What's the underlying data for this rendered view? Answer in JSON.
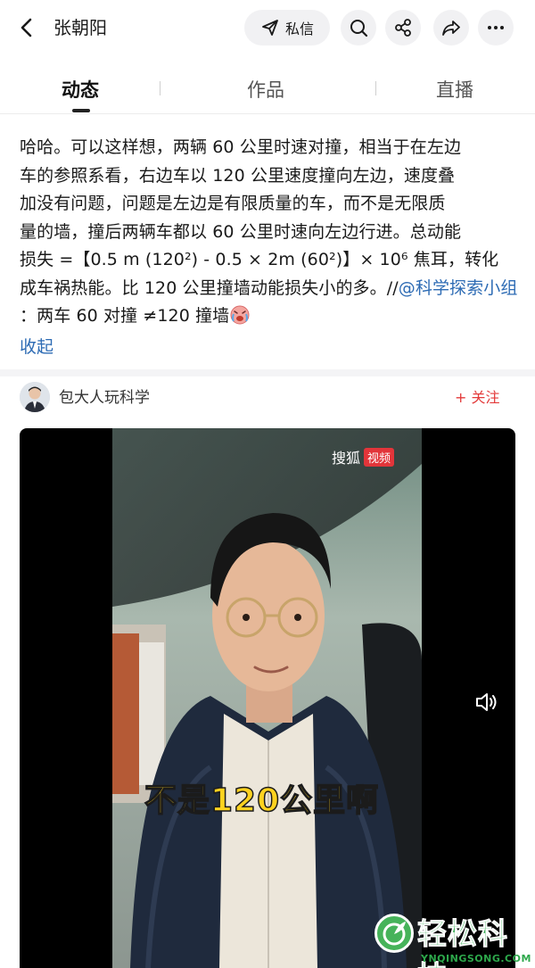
{
  "header": {
    "name": "张朝阳",
    "dm_label": "私信",
    "icons": [
      "back-icon",
      "send-icon",
      "search-icon",
      "share-icon",
      "forward-icon",
      "more-icon"
    ]
  },
  "tabs": [
    {
      "label": "动态",
      "active": true
    },
    {
      "label": "作品",
      "active": false
    },
    {
      "label": "直播",
      "active": false
    }
  ],
  "post": {
    "line1": "哈哈。可以这样想，两辆 60 公里时速对撞，相当于在左边",
    "line2": "车的参照系看，右边车以 120 公里速度撞向左边，速度叠",
    "line3": "加没有问题，问题是左边是有限质量的车，而不是无限质",
    "line4": "量的墙，撞后两辆车都以 60 公里时速向左边行进。总动能",
    "line5": "损失 =【0.5 m (120²) - 0.5 × 2m (60²)】× 10⁶ 焦耳，转化",
    "line6": "成车祸热能。比 120 公里撞墙动能损失小的多。//",
    "mention": "@科学探索小组",
    "tail": "：两车 60 对撞 ≠120 撞墙",
    "collapse": "收起"
  },
  "repost": {
    "author": "包大人玩科学",
    "follow": "+ 关注"
  },
  "video": {
    "watermark_text": "搜狐",
    "watermark_badge": "视频",
    "caption": "不是120公里啊"
  },
  "site_logo": {
    "name": "轻松科技",
    "domain": "YNQINGSONG.COM"
  },
  "colors": {
    "accent_blue": "#2d6bb4",
    "follow_red": "#e33a3a",
    "caption_yellow": "#ffd21f",
    "logo_green": "#2da84b"
  }
}
